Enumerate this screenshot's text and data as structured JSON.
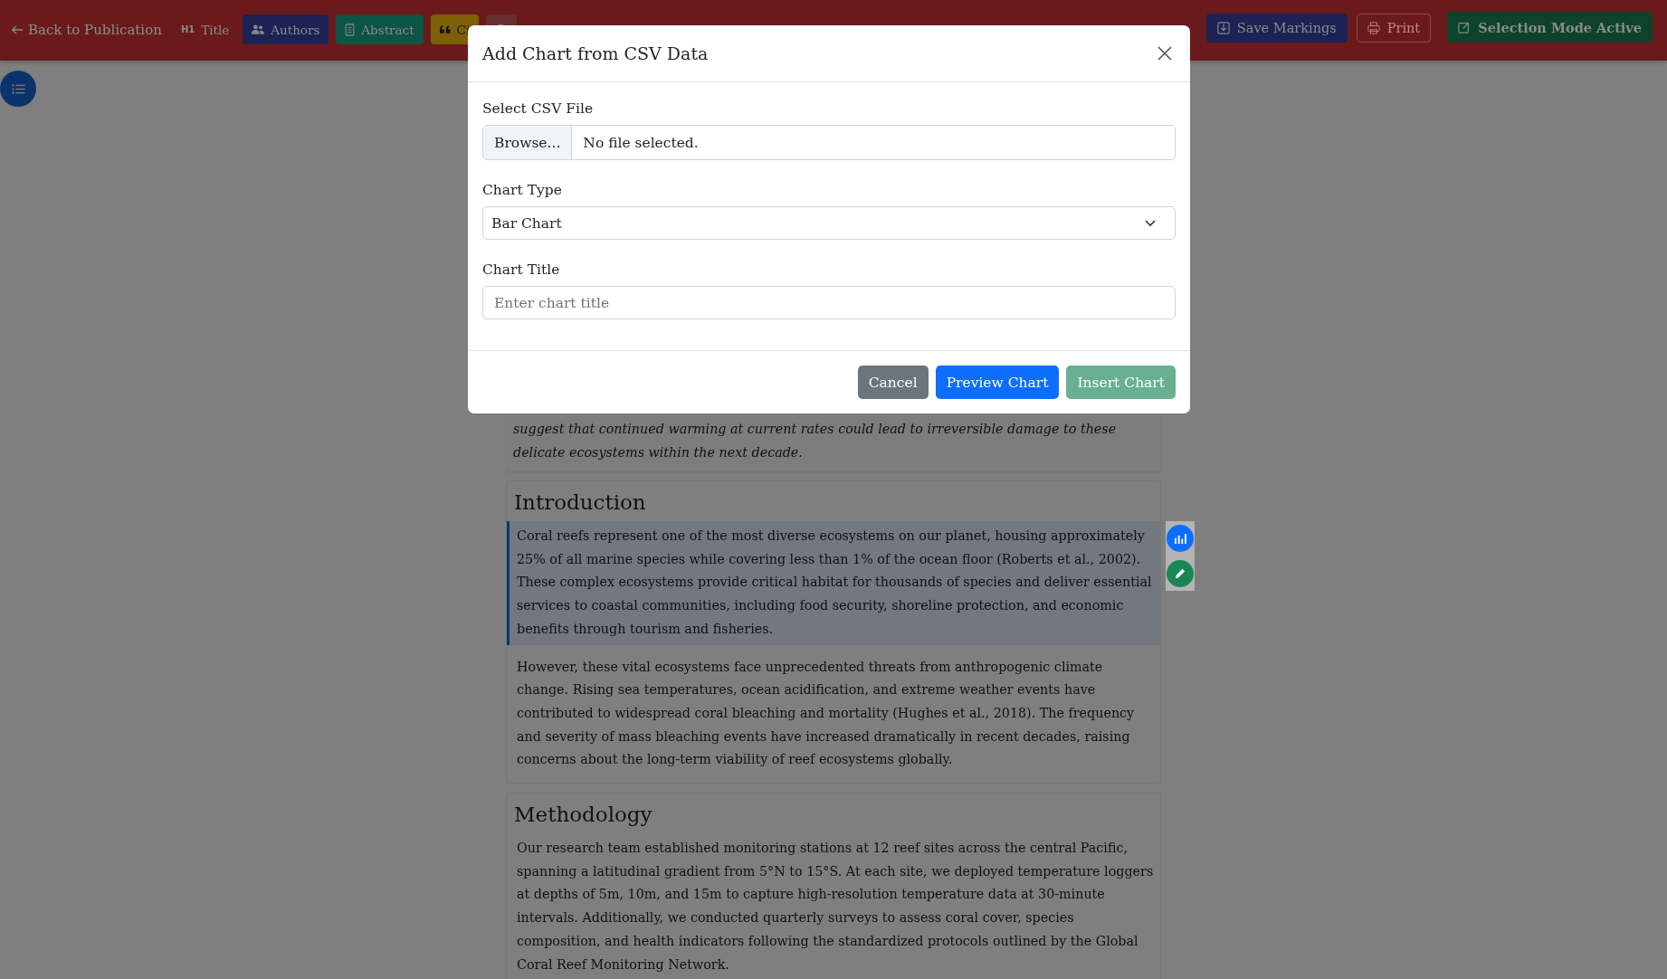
{
  "toolbar": {
    "back_link": "Back to Publication",
    "sections": [
      {
        "kind": "plain",
        "badge": "H1",
        "label": "Title"
      },
      {
        "kind": "filled",
        "label": "Authors",
        "color": "#1d2254"
      },
      {
        "kind": "filled",
        "label": "Abstract",
        "color": "#0c5445"
      },
      {
        "kind": "filled",
        "label": "Ci",
        "color": "#7e6004"
      },
      {
        "kind": "filled",
        "color": "#682d31"
      }
    ],
    "actions": [
      {
        "kind": "filled",
        "label": "Save Markings",
        "color": "#1d2254"
      },
      {
        "kind": "outline",
        "label": "Print"
      },
      {
        "kind": "filled",
        "label": "Selection Mode Active",
        "color": "#0c432a"
      }
    ]
  },
  "document": {
    "abstract_text": "suggest that continued warming at current rates could lead to irreversible damage to these delicate ecosystems within the next decade.",
    "sections": [
      {
        "heading": "Introduction",
        "paragraphs": [
          {
            "text": "Coral reefs represent one of the most diverse ecosystems on our planet, housing approximately 25% of all marine species while covering less than 1% of the ocean floor (Roberts et al., 2002). These complex ecosystems provide critical habitat for thousands of species and deliver essential services to coastal communities, including food security, shoreline protection, and economic benefits through tourism and fisheries.",
            "selected": true
          },
          {
            "text": "However, these vital ecosystems face unprecedented threats from anthropogenic climate change. Rising sea temperatures, ocean acidification, and extreme weather events have contributed to widespread coral bleaching and mortality (Hughes et al., 2018). The frequency and severity of mass bleaching events have increased dramatically in recent decades, raising concerns about the long-term viability of reef ecosystems globally.",
            "selected": false
          }
        ]
      },
      {
        "heading": "Methodology",
        "paragraphs": [
          {
            "text": "Our research team established monitoring stations at 12 reef sites across the central Pacific, spanning a latitudinal gradient from 5°N to 15°S. At each site, we deployed temperature loggers at depths of 5m, 10m, and 15m to capture high-resolution temperature data at 30-minute intervals. Additionally, we conducted quarterly surveys to assess coral cover, species composition, and health indicators following the standardized protocols outlined by the Global Coral Reef Monitoring Network.",
            "selected": false
          }
        ]
      }
    ]
  },
  "modal": {
    "title": "Add Chart from CSV Data",
    "fields": [
      {
        "kind": "file",
        "label": "Select CSV File",
        "button": "Browse...",
        "value": "No file selected."
      },
      {
        "kind": "select",
        "label": "Chart Type",
        "value": "Bar Chart"
      },
      {
        "kind": "text",
        "label": "Chart Title",
        "placeholder": "Enter chart title"
      }
    ],
    "buttons": [
      {
        "kind": "secondary",
        "label": "Cancel",
        "disabled": false
      },
      {
        "kind": "primary",
        "label": "Preview Chart",
        "disabled": false
      },
      {
        "kind": "success",
        "label": "Insert Chart",
        "disabled": true
      }
    ]
  }
}
